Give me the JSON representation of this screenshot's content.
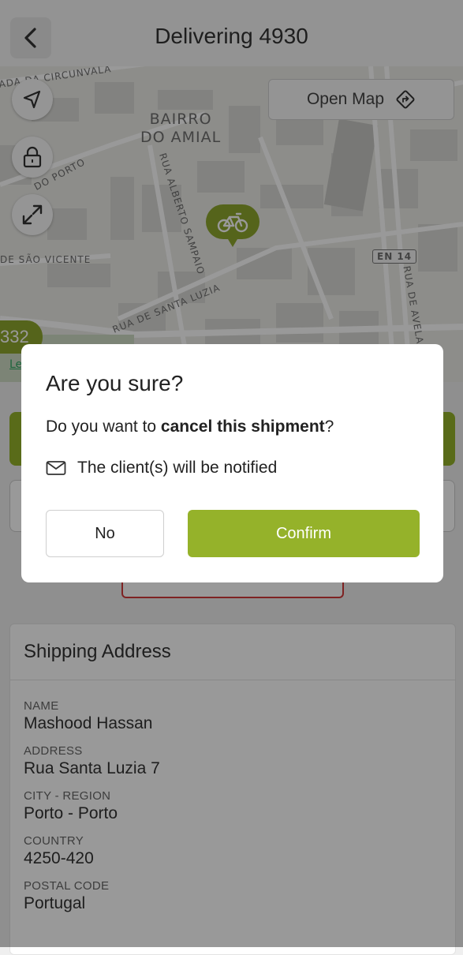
{
  "header": {
    "title": "Delivering 4930",
    "back_icon": "chevron-left-icon"
  },
  "map": {
    "open_map_label": "Open Map",
    "labels": {
      "circunvalacao": "ADA DA CIRCUNVALA",
      "bairro_line1": "BAIRRO",
      "bairro_line2": "DO AMIAL",
      "do_porto": "DO PORTO",
      "alberto_sampaio": "RUA ALBERTO SAMPAIO",
      "sao_vicente": "DE SÃO VICENTE",
      "santa_luzia": "RUA DE SANTA LUZIA",
      "en14": "EN 14",
      "avelar": "RUA DE AVELAR"
    },
    "badge": "332",
    "attribution": "Le",
    "pin_color": "#8ea72e"
  },
  "dialog": {
    "title": "Are you sure?",
    "question_prefix": "Do you want to ",
    "question_bold": "cancel this shipment",
    "question_suffix": "?",
    "notify_text": "The client(s) will be notified",
    "no_label": "No",
    "confirm_label": "Confirm",
    "confirm_color": "#95b22a"
  },
  "shipping": {
    "title": "Shipping Address",
    "fields": [
      {
        "label": "NAME",
        "value": "Mashood Hassan"
      },
      {
        "label": "ADDRESS",
        "value": "Rua Santa Luzia 7"
      },
      {
        "label": "CITY - REGION",
        "value": "Porto - Porto"
      },
      {
        "label": "COUNTRY",
        "value": "4250-420"
      },
      {
        "label": "POSTAL CODE",
        "value": "Portugal"
      }
    ]
  }
}
